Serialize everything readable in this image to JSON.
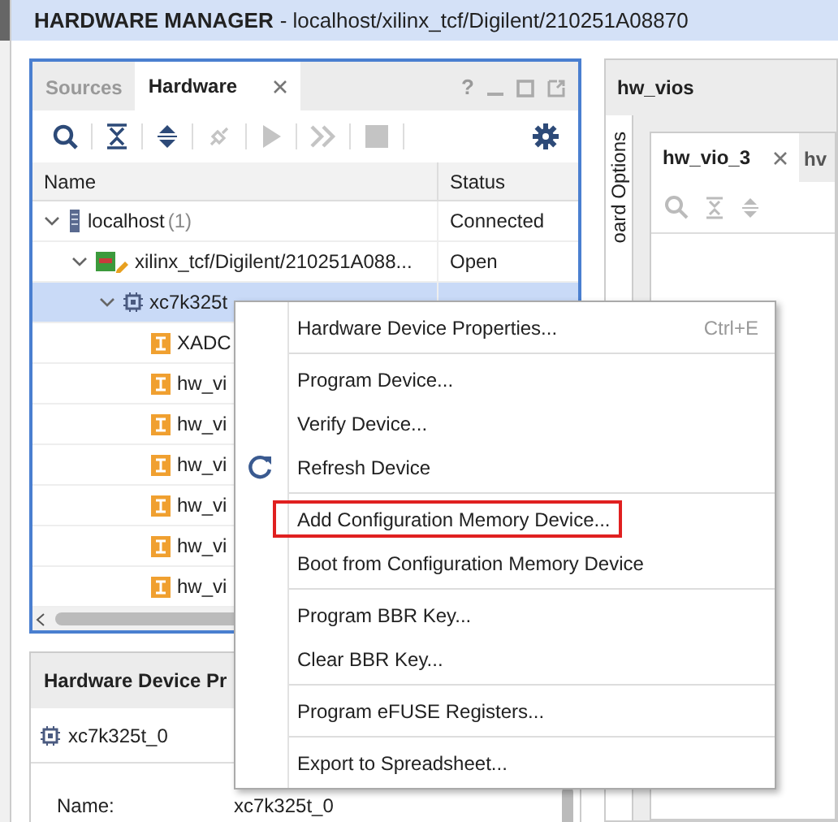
{
  "title_bar": {
    "title": "HARDWARE MANAGER",
    "path": "- localhost/xilinx_tcf/Digilent/210251A08870"
  },
  "hardware_panel": {
    "tabs": [
      {
        "label": "Sources",
        "selected": false,
        "closable": false
      },
      {
        "label": "Hardware",
        "selected": true,
        "closable": true
      }
    ],
    "help_glyph": "?",
    "toolbar": [
      {
        "kind": "search",
        "disabled": false
      },
      {
        "kind": "collapse",
        "disabled": false
      },
      {
        "kind": "expand",
        "disabled": false
      },
      {
        "kind": "connect",
        "disabled": true
      },
      {
        "kind": "run",
        "disabled": true
      },
      {
        "kind": "step",
        "disabled": true
      },
      {
        "kind": "stop",
        "disabled": true
      },
      {
        "kind": "gear",
        "disabled": false
      }
    ],
    "columns": [
      "Name",
      "Status"
    ],
    "tree": [
      {
        "name": "localhost",
        "count": "(1)",
        "status": "Connected",
        "kind": "server",
        "expanded": true,
        "selected": false,
        "children": [
          {
            "name": "xilinx_tcf/Digilent/210251A088...",
            "status": "Open",
            "kind": "board",
            "expanded": true,
            "selected": false,
            "children": [
              {
                "name": "xc7k325t",
                "kind": "chip",
                "expanded": true,
                "selected": true,
                "children": [
                  {
                    "name": "XADC",
                    "kind": "core",
                    "selected": false
                  },
                  {
                    "name": "hw_vi",
                    "kind": "core",
                    "selected": false
                  },
                  {
                    "name": "hw_vi",
                    "kind": "core",
                    "selected": false
                  },
                  {
                    "name": "hw_vi",
                    "kind": "core",
                    "selected": false
                  },
                  {
                    "name": "hw_vi",
                    "kind": "core",
                    "selected": false
                  },
                  {
                    "name": "hw_vi",
                    "kind": "core",
                    "selected": false
                  },
                  {
                    "name": "hw_vi",
                    "kind": "core",
                    "selected": false
                  }
                ]
              }
            ]
          }
        ]
      }
    ]
  },
  "properties_panel": {
    "title": "Hardware Device Pr",
    "device": "xc7k325t_0",
    "fields": [
      {
        "label": "Name:",
        "value": "xc7k325t_0"
      }
    ]
  },
  "right_panel": {
    "title": "hw_vios",
    "side_tab": "oard Options",
    "tabs": [
      {
        "label": "hw_vio_3",
        "selected": true,
        "closable": true
      },
      {
        "label": "hv",
        "selected": false,
        "closable": false
      }
    ]
  },
  "context_menu": {
    "items": [
      {
        "label": "Hardware Device Properties...",
        "kind": "plain",
        "shortcut": "Ctrl+E",
        "separator_after": true,
        "highlighted": false
      },
      {
        "label": "Program Device...",
        "kind": "plain",
        "separator_after": false,
        "highlighted": false
      },
      {
        "label": "Verify Device...",
        "kind": "plain",
        "separator_after": false,
        "highlighted": false
      },
      {
        "label": "Refresh Device",
        "kind": "refresh",
        "separator_after": true,
        "highlighted": false
      },
      {
        "label": "Add Configuration Memory Device...",
        "kind": "plain",
        "separator_after": false,
        "highlighted": true
      },
      {
        "label": "Boot from Configuration Memory Device",
        "kind": "plain",
        "separator_after": true,
        "highlighted": false
      },
      {
        "label": "Program BBR Key...",
        "kind": "plain",
        "separator_after": false,
        "highlighted": false
      },
      {
        "label": "Clear BBR Key...",
        "kind": "plain",
        "separator_after": true,
        "highlighted": false
      },
      {
        "label": "Program eFUSE Registers...",
        "kind": "plain",
        "separator_after": true,
        "highlighted": false
      },
      {
        "label": "Export to Spreadsheet...",
        "kind": "plain",
        "separator_after": false,
        "highlighted": false
      }
    ]
  }
}
